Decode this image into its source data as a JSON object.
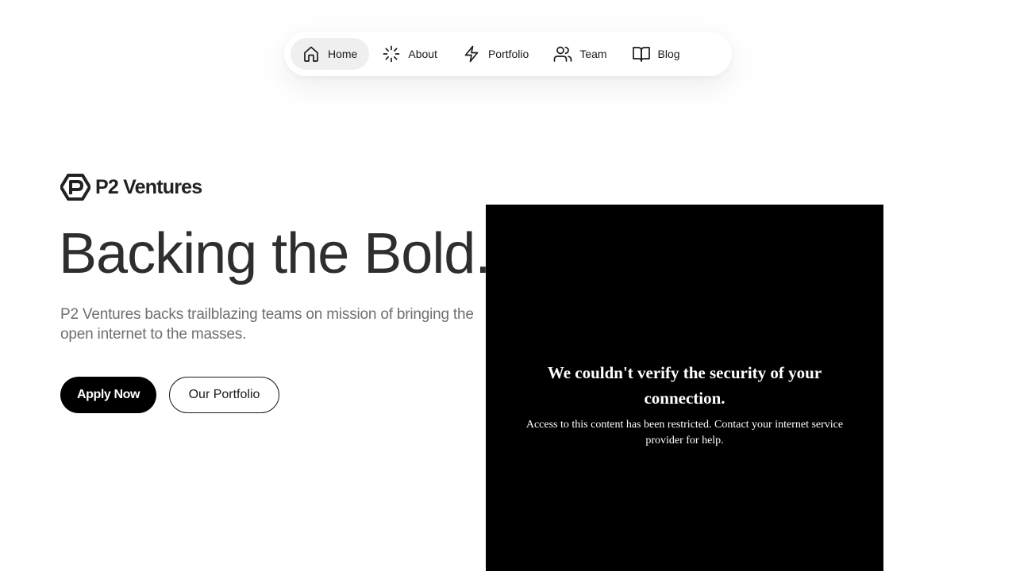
{
  "nav": {
    "items": [
      {
        "label": "Home",
        "icon": "home-icon",
        "active": true
      },
      {
        "label": "About",
        "icon": "loader-icon",
        "active": false
      },
      {
        "label": "Portfolio",
        "icon": "lightning-icon",
        "active": false
      },
      {
        "label": "Team",
        "icon": "users-icon",
        "active": false
      },
      {
        "label": "Blog",
        "icon": "book-icon",
        "active": false
      }
    ]
  },
  "brand": {
    "name": "P2 Ventures",
    "logo_icon": "p2-logo-icon"
  },
  "hero": {
    "title": "Backing the Bold.",
    "subtitle": "P2 Ventures backs trailblazing teams on mission of bringing the open internet to the masses.",
    "primary_button": "Apply Now",
    "secondary_button": "Our Portfolio"
  },
  "overlay": {
    "title": "We couldn't verify the security of your connection.",
    "message": "Access to this content has been restricted. Contact your internet service provider for help."
  },
  "colors": {
    "background": "#ffffff",
    "text_dark": "#2e2e2e",
    "text_muted": "#6f6f6f",
    "button_primary": "#000000",
    "nav_active": "#efefef",
    "overlay_bg": "#000000"
  }
}
